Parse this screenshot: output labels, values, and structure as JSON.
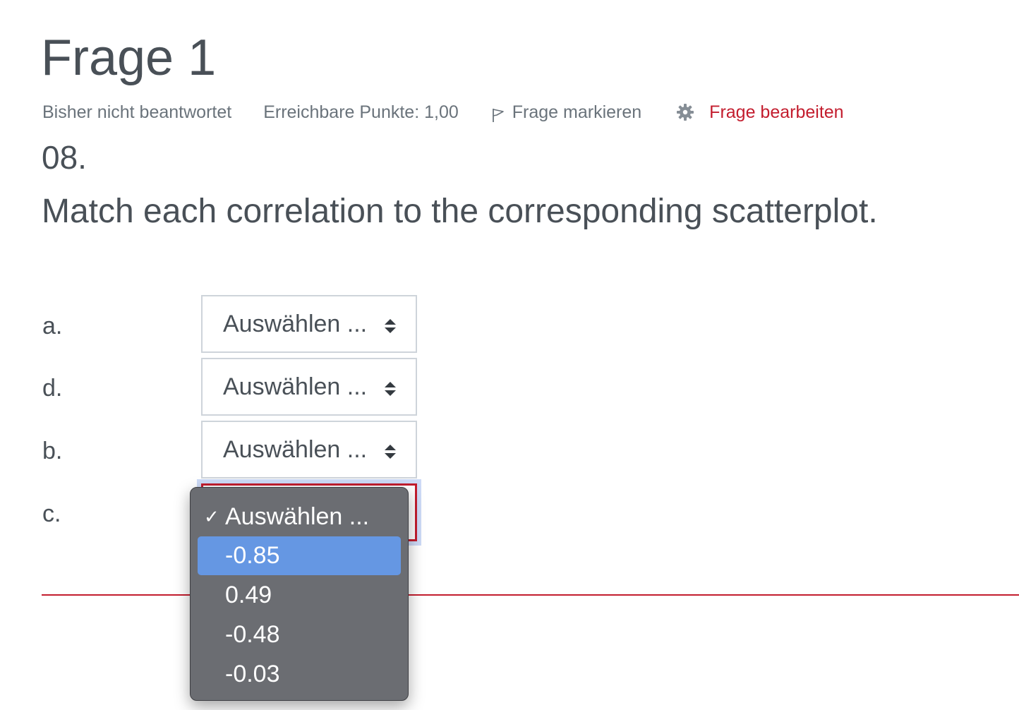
{
  "question": {
    "title": "Frage 1",
    "status": "Bisher nicht beantwortet",
    "points": "Erreichbare Punkte: 1,00",
    "flag_label": "Frage markieren",
    "edit_label": "Frage bearbeiten",
    "number": "08.",
    "text": "Match each correlation to the corresponding scatterplot."
  },
  "rows": [
    {
      "label": "a.",
      "select_value": "Auswählen ..."
    },
    {
      "label": "d.",
      "select_value": "Auswählen ..."
    },
    {
      "label": "b.",
      "select_value": "Auswählen ..."
    },
    {
      "label": "c.",
      "select_value": "Auswählen ..."
    }
  ],
  "dropdown": {
    "checkmark": "✓",
    "options": [
      "Auswählen ...",
      "-0.85",
      "0.49",
      "-0.48",
      "-0.03"
    ],
    "selected_option": "Auswählen ...",
    "highlighted_option": "-0.85"
  },
  "colors": {
    "accent_red": "#c31d2e",
    "text": "#495057",
    "highlight_blue": "#6597e3",
    "menu_bg": "#6b6d72"
  },
  "icons": {
    "flag": "flag-icon",
    "gear": "gear-icon",
    "select_arrows": "select-arrows-icon",
    "check": "checkmark-icon"
  }
}
